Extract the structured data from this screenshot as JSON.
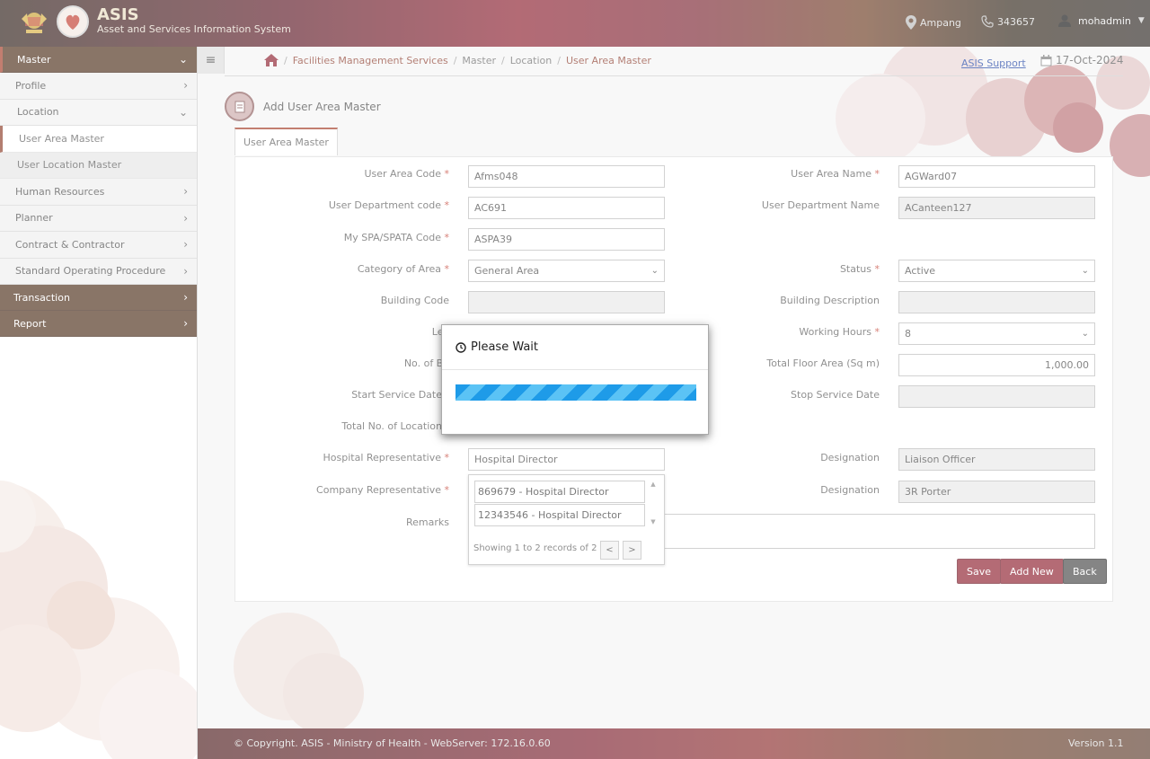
{
  "header": {
    "app_name": "ASIS",
    "app_subtitle": "Asset and Services Information System",
    "location": "Ampang",
    "extension": "343657",
    "user": "mohadmin"
  },
  "sidebar": {
    "items": [
      {
        "label": "Master"
      },
      {
        "label": "Profile"
      },
      {
        "label": "Location"
      },
      {
        "label": "User Area Master"
      },
      {
        "label": "User Location Master"
      },
      {
        "label": "Human Resources"
      },
      {
        "label": "Planner"
      },
      {
        "label": "Contract & Contractor"
      },
      {
        "label": "Standard Operating Procedure"
      },
      {
        "label": "Transaction"
      },
      {
        "label": "Report"
      }
    ]
  },
  "breadcrumb": [
    "Facilities Management Services",
    "Master",
    "Location",
    "User Area Master"
  ],
  "support_link": "ASIS Support",
  "date": "17-Oct-2024",
  "page_title": "Add User Area Master",
  "tab_label": "User Area Master",
  "form": {
    "user_area_code": {
      "label": "User Area Code",
      "value": "Afms048"
    },
    "user_area_name": {
      "label": "User Area Name",
      "value": "AGWard07"
    },
    "user_dept_code": {
      "label": "User Department code",
      "value": "AC691"
    },
    "user_dept_name": {
      "label": "User Department Name",
      "value": "ACanteen127"
    },
    "spa_code": {
      "label": "My SPA/SPATA Code",
      "value": "ASPA39"
    },
    "category": {
      "label": "Category of Area",
      "value": "General Area"
    },
    "status": {
      "label": "Status",
      "value": "Active"
    },
    "building_code": {
      "label": "Building Code",
      "value": ""
    },
    "building_desc": {
      "label": "Building Description",
      "value": ""
    },
    "level": {
      "label": "Lev"
    },
    "working_hours": {
      "label": "Working Hours",
      "value": "8"
    },
    "no_of_beds": {
      "label": "No. of Be"
    },
    "total_floor_area": {
      "label": "Total Floor Area (Sq m)",
      "value": "1,000.00"
    },
    "start_service_date": {
      "label": "Start Service Date"
    },
    "stop_service_date": {
      "label": "Stop Service Date",
      "value": ""
    },
    "total_locations": {
      "label": "Total No. of Location"
    },
    "hospital_rep": {
      "label": "Hospital Representative",
      "value": "Hospital Director"
    },
    "designation1": {
      "label": "Designation",
      "value": "Liaison Officer"
    },
    "company_rep": {
      "label": "Company Representative"
    },
    "designation2": {
      "label": "Designation",
      "value": "3R Porter"
    },
    "remarks": {
      "label": "Remarks",
      "value": ""
    }
  },
  "dropdown": {
    "options": [
      "869679 - Hospital Director",
      "12343546 - Hospital Director"
    ],
    "footer": "Showing 1 to 2 records of 2",
    "prev": "<",
    "next": ">"
  },
  "buttons": {
    "save": "Save",
    "add_new": "Add New",
    "back": "Back"
  },
  "modal": {
    "title": "Please Wait",
    "progress": 1.0
  },
  "footer": {
    "copyright": "© Copyright. ASIS - Ministry of Health - WebServer: 172.16.0.60",
    "version": "Version 1.1"
  },
  "colors": {
    "brand": "#8c1c2c",
    "sidebar_dark": "#4b2b16",
    "progress": "#1e9be8"
  }
}
